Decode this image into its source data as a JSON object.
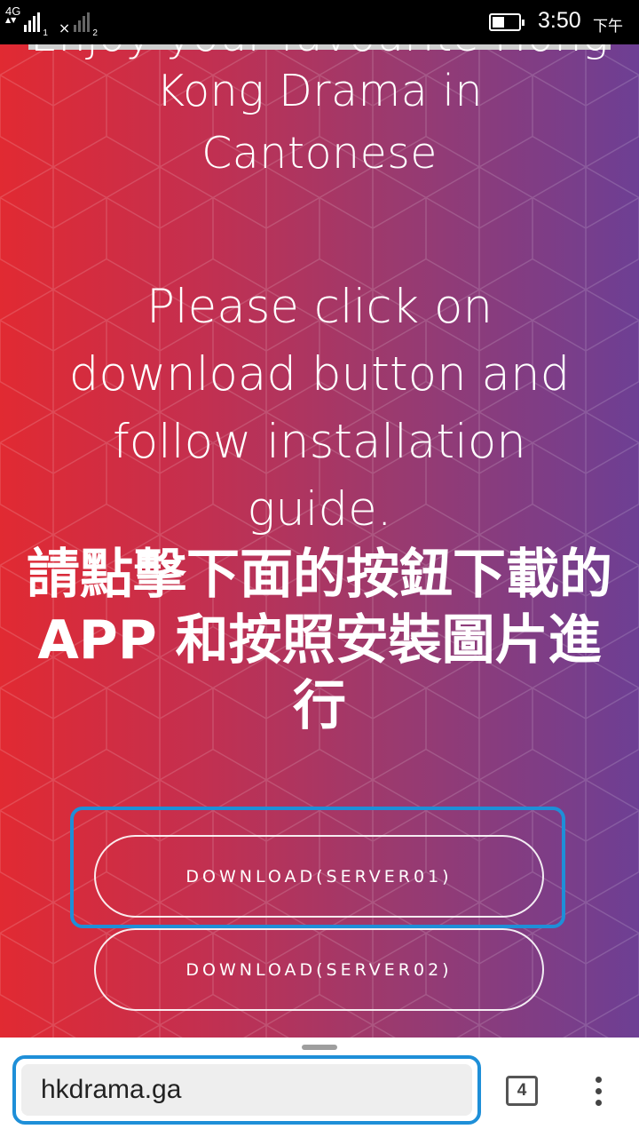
{
  "status_bar": {
    "network_type": "4G",
    "sim1_label": "1",
    "sim2_label": "2",
    "sim2_no_service": "×",
    "battery_level": 0.45,
    "time": "3:50",
    "ampm": "下午"
  },
  "page": {
    "title_cut_line": "Enjoy your favourite Hong",
    "title_lines": [
      "Kong Drama in",
      "Cantonese"
    ],
    "instruction_lines": [
      "Please click on",
      "download button and",
      "follow installation",
      "guide."
    ],
    "chinese_instruction": "請點擊下面的按鈕下載的 APP 和按照安裝圖片進行",
    "buttons": {
      "server01": "DOWNLOAD(SERVER01)",
      "server02": "DOWNLOAD(SERVER02)"
    },
    "background_colors": [
      "#e12a32",
      "#6d3f94"
    ],
    "highlight_color": "#1e8fd8"
  },
  "browser": {
    "url": "hkdrama.ga",
    "tab_count": "4",
    "menu_icon": "more-vertical-icon"
  }
}
